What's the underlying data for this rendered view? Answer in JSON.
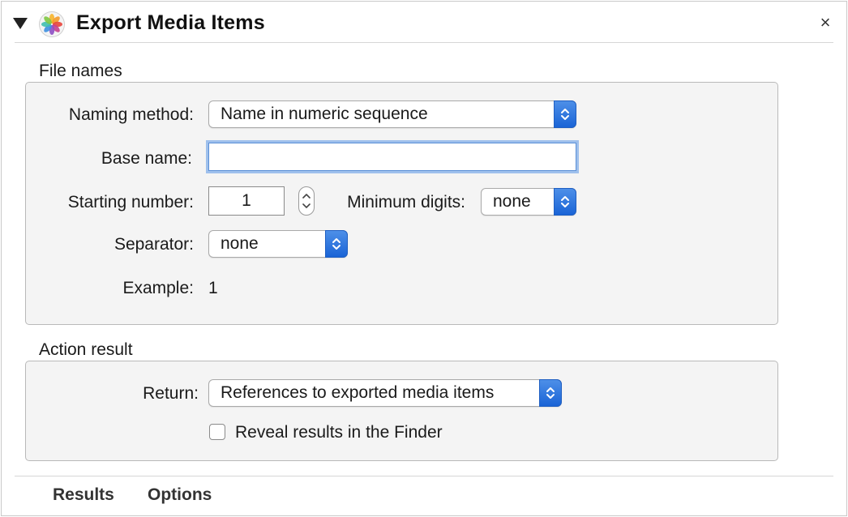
{
  "header": {
    "title": "Export Media Items",
    "app_icon": "photos-icon",
    "close_glyph": "×"
  },
  "file_names": {
    "section_label": "File names",
    "naming_method": {
      "label": "Naming method:",
      "value": "Name in numeric sequence"
    },
    "base_name": {
      "label": "Base name:",
      "value": "",
      "focused": true
    },
    "starting_number": {
      "label": "Starting number:",
      "value": "1"
    },
    "minimum_digits": {
      "label": "Minimum digits:",
      "value": "none"
    },
    "separator": {
      "label": "Separator:",
      "value": "none"
    },
    "example": {
      "label": "Example:",
      "value": "1"
    }
  },
  "action_result": {
    "section_label": "Action result",
    "return": {
      "label": "Return:",
      "value": "References to exported media items"
    },
    "reveal": {
      "label": "Reveal results in the Finder",
      "checked": false
    }
  },
  "footer": {
    "tabs": [
      {
        "label": "Results"
      },
      {
        "label": "Options"
      }
    ]
  },
  "colors": {
    "accent": "#1a64d6",
    "focus_ring": "#9fc0ec",
    "group_bg": "#f4f4f4"
  }
}
